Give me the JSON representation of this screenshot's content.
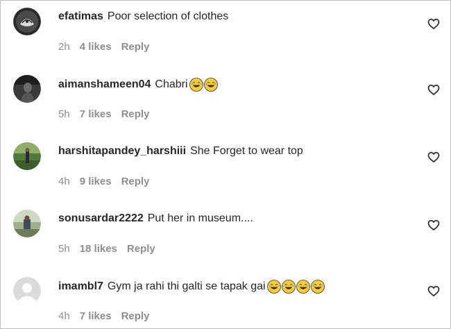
{
  "comments": [
    {
      "username": "efatimas",
      "text": "Poor selection of clothes",
      "time": "2h",
      "likes": "4 likes",
      "reply": "Reply",
      "emojis": [],
      "avatar": "avatar-efatimas-icon"
    },
    {
      "username": "aimanshameen04",
      "text": "Chabri",
      "time": "5h",
      "likes": "7 likes",
      "reply": "Reply",
      "emojis": [
        "laughing-emoji",
        "laughing-emoji"
      ],
      "avatar": "avatar-aimanshameen04-icon"
    },
    {
      "username": "harshitapandey_harshiii",
      "text": "She Forget to wear top",
      "time": "4h",
      "likes": "9 likes",
      "reply": "Reply",
      "emojis": [],
      "avatar": "avatar-harshitapandey-icon"
    },
    {
      "username": "sonusardar2222",
      "text": "Put her in museum....",
      "time": "5h",
      "likes": "18 likes",
      "reply": "Reply",
      "emojis": [],
      "avatar": "avatar-sonusardar-icon"
    },
    {
      "username": "imambl7",
      "text": "Gym ja rahi thi galti se tapak gai",
      "time": "4h",
      "likes": "7 likes",
      "reply": "Reply",
      "emojis": [
        "laughing-emoji",
        "laughing-emoji",
        "laughing-emoji",
        "laughing-emoji"
      ],
      "avatar": "default-avatar-icon"
    }
  ],
  "colors": {
    "text": "#262626",
    "secondary": "#8e8e8e",
    "border": "#bdbdbd",
    "emoji": "#ffcc33"
  }
}
